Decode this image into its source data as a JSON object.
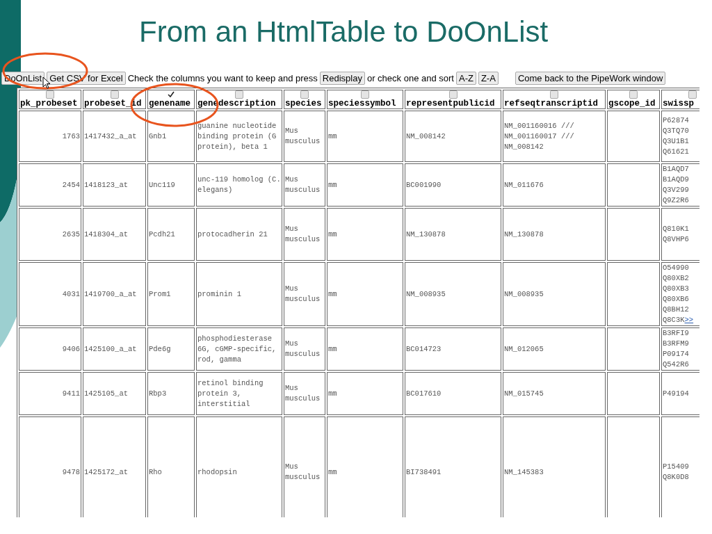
{
  "slide_title": "From an HtmlTable to DoOnList",
  "toolbar": [
    {
      "kind": "button",
      "text": "DoOnList"
    },
    {
      "kind": "button",
      "text": "Get CSV for Excel"
    },
    {
      "kind": "text",
      "text": "Check the columns you want to keep and press"
    },
    {
      "kind": "button",
      "text": "Redisplay"
    },
    {
      "kind": "text",
      "text": "or check one and sort"
    },
    {
      "kind": "button",
      "text": "A-Z"
    },
    {
      "kind": "button",
      "text": "Z-A"
    },
    {
      "kind": "spacer"
    },
    {
      "kind": "button",
      "text": "Come back to the PipeWork window"
    }
  ],
  "table": {
    "columns": [
      {
        "name": "pk_probeset",
        "checked": false
      },
      {
        "name": "probeset_id",
        "checked": false
      },
      {
        "name": "genename",
        "checked": true
      },
      {
        "name": "genedescription",
        "checked": false
      },
      {
        "name": "species",
        "checked": false
      },
      {
        "name": "speciessymbol",
        "checked": false
      },
      {
        "name": "representpublicid",
        "checked": false
      },
      {
        "name": "refseqtranscriptid",
        "checked": false
      },
      {
        "name": "gscope_id",
        "checked": false
      },
      {
        "name": "swissp",
        "checked": false
      }
    ],
    "rows": [
      {
        "pk_probeset": "1763",
        "probeset_id": "1417432_a_at",
        "genename": "Gnb1",
        "genedescription": "guanine nucleotide binding protein (G protein), beta 1",
        "species": "Mus musculus",
        "speciessymbol": "mm",
        "representpublicid": "NM_008142",
        "refseqtranscriptid": [
          "NM_001160016 ///",
          "NM_001160017 ///",
          "NM_008142"
        ],
        "swissp": [
          "P62874",
          "Q3TQ70",
          "Q3U1B1",
          "Q61621"
        ]
      },
      {
        "pk_probeset": "2454",
        "probeset_id": "1418123_at",
        "genename": "Unc119",
        "genedescription": "unc-119 homolog (C. elegans)",
        "species": "Mus musculus",
        "speciessymbol": "mm",
        "representpublicid": "BC001990",
        "refseqtranscriptid": [
          "NM_011676"
        ],
        "swissp": [
          "B1AQD7",
          "B1AQD9",
          "Q3V299",
          "Q9Z2R6"
        ]
      },
      {
        "pk_probeset": "2635",
        "probeset_id": "1418304_at",
        "genename": "Pcdh21",
        "genedescription": "protocadherin 21",
        "species": "Mus musculus",
        "speciessymbol": "mm",
        "representpublicid": "NM_130878",
        "refseqtranscriptid": [
          "NM_130878"
        ],
        "swissp": [
          "Q810K1",
          "Q8VHP6"
        ]
      },
      {
        "pk_probeset": "4031",
        "probeset_id": "1419700_a_at",
        "genename": "Prom1",
        "genedescription": "prominin 1",
        "species": "Mus musculus",
        "speciessymbol": "mm",
        "representpublicid": "NM_008935",
        "refseqtranscriptid": [
          "NM_008935"
        ],
        "swissp": [
          "O54990",
          "Q80XB2",
          "Q80XB3",
          "Q80XB6",
          "Q8BH12",
          "Q8C3K"
        ],
        "more_link": ">>"
      },
      {
        "pk_probeset": "9406",
        "probeset_id": "1425100_a_at",
        "genename": "Pde6g",
        "genedescription": "phosphodiesterase 6G, cGMP-specific, rod, gamma",
        "species": "Mus musculus",
        "speciessymbol": "mm",
        "representpublicid": "BC014723",
        "refseqtranscriptid": [
          "NM_012065"
        ],
        "swissp": [
          "B3RFI9",
          "B3RFM9",
          "P09174",
          "Q542R6"
        ]
      },
      {
        "pk_probeset": "9411",
        "probeset_id": "1425105_at",
        "genename": "Rbp3",
        "genedescription": "retinol binding protein 3, interstitial",
        "species": "Mus musculus",
        "speciessymbol": "mm",
        "representpublicid": "BC017610",
        "refseqtranscriptid": [
          "NM_015745"
        ],
        "swissp": [
          "P49194"
        ]
      },
      {
        "pk_probeset": "9478",
        "probeset_id": "1425172_at",
        "genename": "Rho",
        "genedescription": "rhodopsin",
        "species": "Mus musculus",
        "speciessymbol": "mm",
        "representpublicid": "BI738491",
        "refseqtranscriptid": [
          "NM_145383"
        ],
        "swissp": [
          "P15409",
          "Q8K0D8"
        ]
      }
    ]
  }
}
